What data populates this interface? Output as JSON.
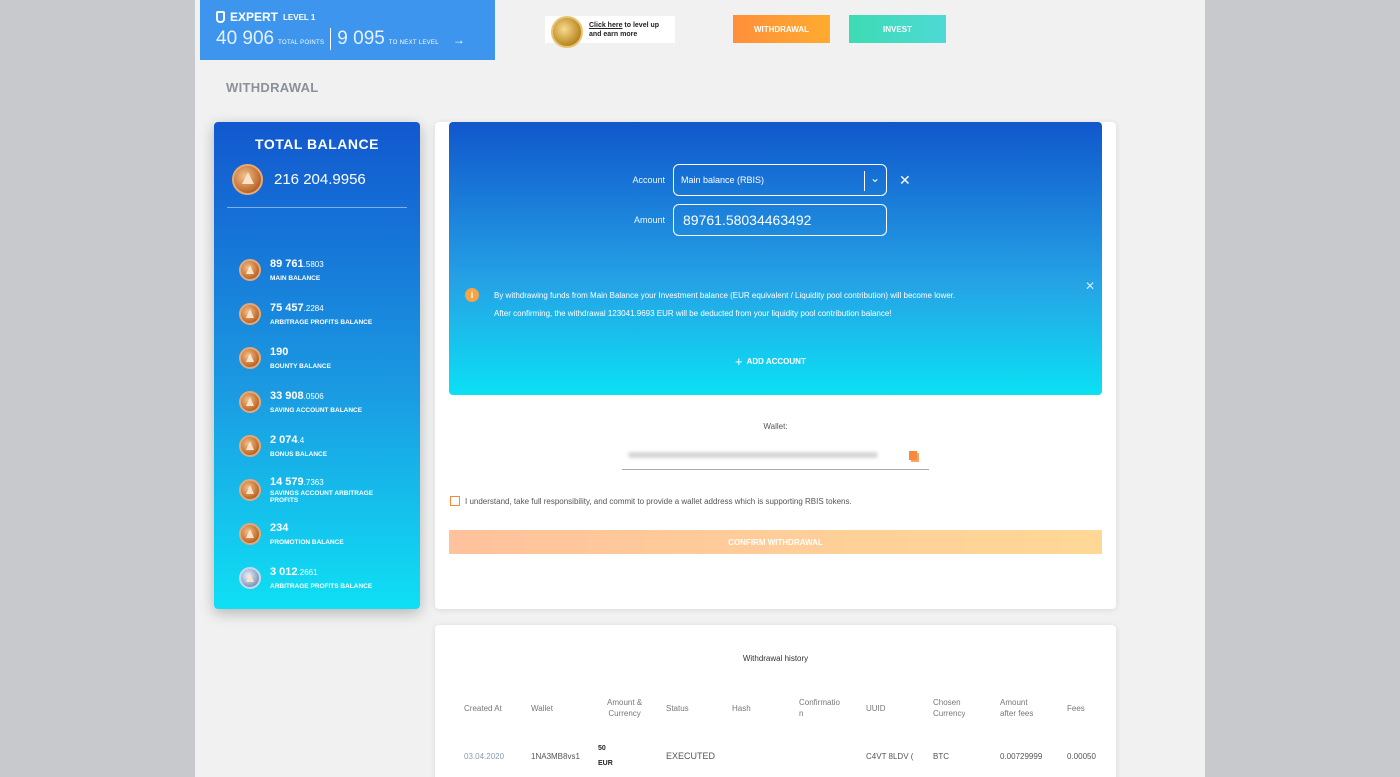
{
  "level": {
    "title": "EXPERT",
    "level_label": "LEVEL 1",
    "total_points": "40 906",
    "total_points_label": "TOTAL POINTS",
    "next_level_points": "9 095",
    "next_level_label": "TO NEXT LEVEL"
  },
  "levelup": {
    "link": "Click here",
    "text1": " to level up",
    "text2": "and earn more"
  },
  "nav": {
    "withdrawal": "WITHDRAWAL",
    "invest": "INVEST"
  },
  "page_title": "WITHDRAWAL",
  "balance": {
    "title": "TOTAL BALANCE",
    "total": "216 204.9956",
    "items": [
      {
        "int": "89 761",
        "dec": ".5803",
        "label": "MAIN BALANCE"
      },
      {
        "int": "75 457",
        "dec": ".2284",
        "label": "ARBITRAGE PROFITS BALANCE"
      },
      {
        "int": "190",
        "dec": "",
        "label": "BOUNTY BALANCE"
      },
      {
        "int": "33 908",
        "dec": ".0506",
        "label": "SAVING ACCOUNT BALANCE"
      },
      {
        "int": "2 074",
        "dec": ".4",
        "label": "BONUS BALANCE"
      },
      {
        "int": "14 579",
        "dec": ".7363",
        "label": "SAVINGS ACCOUNT ARBITRAGE PROFITS"
      },
      {
        "int": "234",
        "dec": "",
        "label": "PROMOTION BALANCE"
      },
      {
        "int": "3 012",
        "dec": ".2661",
        "label": "ARBITRAGE PROFITS BALANCE"
      }
    ]
  },
  "form": {
    "account_label": "Account",
    "account_value": "Main balance (RBIS)",
    "amount_label": "Amount",
    "amount_value": "89761.58034463492",
    "notice_line1": "By withdrawing funds from Main Balance your Investment balance (EUR equivalent / Liquidity pool contribution) will become lower.",
    "notice_line2": "After confirming, the withdrawal 123041.9693 EUR will be deducted from your liquidity pool contribution balance!",
    "add_account": "ADD ACCOUNT",
    "wallet_label": "Wallet:",
    "consent": "I understand, take full responsibility, and commit to provide a wallet address which is supporting RBIS tokens.",
    "confirm": "CONFIRM WITHDRAWAL"
  },
  "history": {
    "title": "Withdrawal history",
    "headers": [
      "Created At",
      "Wallet",
      "Amount &\nCurrency",
      "Status",
      "Hash",
      "Confirmatio\nn",
      "UUID",
      "Chosen\nCurrency",
      "Amount\nafter fees",
      "Fees"
    ],
    "rows": [
      {
        "created_at": "03.04.2020",
        "wallet": "1NA3MB8vs1",
        "amount": "50",
        "currency": "EUR",
        "status": "EXECUTED",
        "hash": "",
        "confirmation": "",
        "uuid": "C4VT 8LDV (",
        "chosen_currency": "BTC",
        "amount_after_fees": "0.00729999",
        "fees": "0.00050"
      }
    ]
  }
}
